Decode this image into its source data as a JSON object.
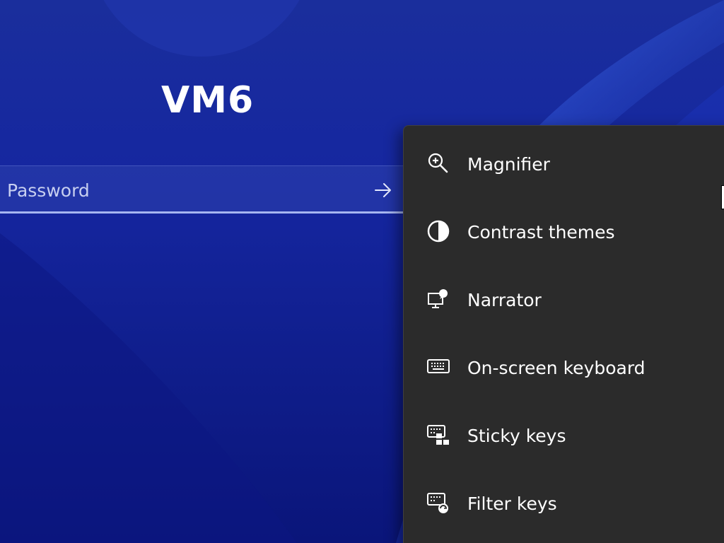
{
  "login": {
    "user_name": "VM6",
    "password_placeholder": "Password"
  },
  "accessibility_menu": {
    "items": [
      {
        "label": "Magnifier",
        "icon": "magnifier-icon"
      },
      {
        "label": "Contrast themes",
        "icon": "contrast-icon"
      },
      {
        "label": "Narrator",
        "icon": "narrator-icon"
      },
      {
        "label": "On-screen keyboard",
        "icon": "keyboard-icon"
      },
      {
        "label": "Sticky keys",
        "icon": "sticky-keys-icon"
      },
      {
        "label": "Filter keys",
        "icon": "filter-keys-icon"
      }
    ]
  },
  "colors": {
    "menu_background": "#2b2b2b",
    "wallpaper_blue": "#1526a0",
    "text": "#ffffff"
  }
}
